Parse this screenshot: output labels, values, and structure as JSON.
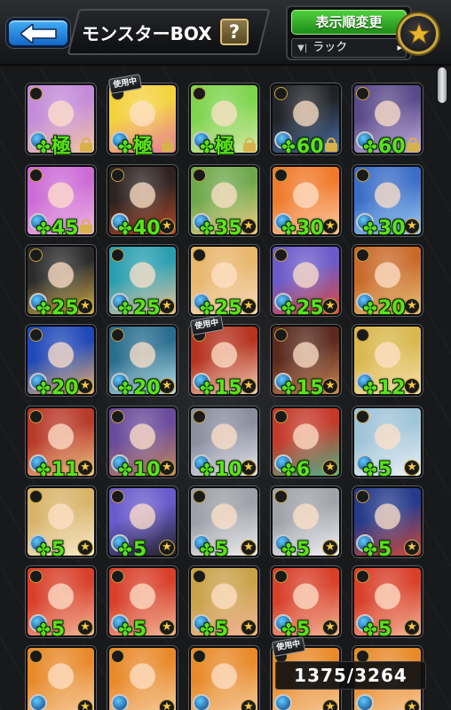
{
  "header": {
    "back_label": "",
    "title": "モンスターBOX",
    "help_label": "?",
    "sort_button_label": "表示順変更",
    "sort_value": "ラック"
  },
  "in_use_label": "使用中",
  "counter": "1375/3264",
  "colors": {
    "level_text": "#5ce21a",
    "back_button": "#2a8ee0",
    "sort_button": "#34ab28",
    "gold": "#c9a53b"
  },
  "icons": [
    "back-arrow-icon",
    "help-icon",
    "filter-icon",
    "dropdown-arrow-icon",
    "favorite-star-icon",
    "clover-icon",
    "lock-icon",
    "element-icon",
    "star-mark-icon"
  ],
  "monsters": [
    {
      "level": "極",
      "palette": [
        "#c38bd8",
        "#f3c6a7"
      ],
      "locked": true,
      "in_use": false
    },
    {
      "level": "極",
      "palette": [
        "#f4d23f",
        "#e87da1"
      ],
      "locked": true,
      "in_use": true
    },
    {
      "level": "極",
      "palette": [
        "#7ed44e",
        "#d7e9a8"
      ],
      "locked": true,
      "in_use": false
    },
    {
      "level": "60",
      "palette": [
        "#202428",
        "#4a6fa5"
      ],
      "locked": true,
      "in_use": false
    },
    {
      "level": "60",
      "palette": [
        "#5b4a8a",
        "#c7b3e2"
      ],
      "locked": true,
      "in_use": false
    },
    {
      "level": "45",
      "palette": [
        "#cc6bd6",
        "#f0b8e4"
      ],
      "locked": true,
      "in_use": false
    },
    {
      "level": "40",
      "palette": [
        "#2e2320",
        "#b84a2a"
      ],
      "locked": false,
      "in_use": false
    },
    {
      "level": "35",
      "palette": [
        "#6fa84c",
        "#f1d08a"
      ],
      "locked": false,
      "in_use": false
    },
    {
      "level": "30",
      "palette": [
        "#f07a2b",
        "#ffd0b0"
      ],
      "locked": false,
      "in_use": false
    },
    {
      "level": "30",
      "palette": [
        "#3c6ec8",
        "#9fd0f4"
      ],
      "locked": false,
      "in_use": false
    },
    {
      "level": "25",
      "palette": [
        "#2b2b2b",
        "#d4b14a"
      ],
      "locked": false,
      "in_use": false
    },
    {
      "level": "25",
      "palette": [
        "#2a9fb0",
        "#f2c69d"
      ],
      "locked": false,
      "in_use": false
    },
    {
      "level": "25",
      "palette": [
        "#e8b66c",
        "#f7dcc0"
      ],
      "locked": false,
      "in_use": false
    },
    {
      "level": "25",
      "palette": [
        "#6b5ac9",
        "#e04c3a"
      ],
      "locked": false,
      "in_use": false
    },
    {
      "level": "20",
      "palette": [
        "#c96a2a",
        "#e8c37a"
      ],
      "locked": false,
      "in_use": false
    },
    {
      "level": "20",
      "palette": [
        "#1f48b8",
        "#f2b56d"
      ],
      "locked": false,
      "in_use": false
    },
    {
      "level": "20",
      "palette": [
        "#2a6e8f",
        "#bfe4e8"
      ],
      "locked": false,
      "in_use": false
    },
    {
      "level": "15",
      "palette": [
        "#b5331f",
        "#f3d3bd"
      ],
      "locked": false,
      "in_use": true
    },
    {
      "level": "15",
      "palette": [
        "#5a2a1e",
        "#c9885a"
      ],
      "locked": false,
      "in_use": false
    },
    {
      "level": "12",
      "palette": [
        "#d9b84e",
        "#f6e3b0"
      ],
      "locked": false,
      "in_use": false
    },
    {
      "level": "11",
      "palette": [
        "#b83a2a",
        "#f2c98a"
      ],
      "locked": false,
      "in_use": false
    },
    {
      "level": "10",
      "palette": [
        "#6a4a9b",
        "#c48a5a"
      ],
      "locked": false,
      "in_use": false
    },
    {
      "level": "10",
      "palette": [
        "#8a8fa0",
        "#e8e8ee"
      ],
      "locked": false,
      "in_use": false
    },
    {
      "level": "6",
      "palette": [
        "#c33a2a",
        "#4fb48a"
      ],
      "locked": false,
      "in_use": false
    },
    {
      "level": "5",
      "palette": [
        "#9fc4d8",
        "#eef3f7"
      ],
      "locked": false,
      "in_use": false
    },
    {
      "level": "5",
      "palette": [
        "#d8b46a",
        "#f8ecd0"
      ],
      "locked": false,
      "in_use": false
    },
    {
      "level": "5",
      "palette": [
        "#6a5acb",
        "#222226"
      ],
      "locked": false,
      "in_use": false
    },
    {
      "level": "5",
      "palette": [
        "#9da0a8",
        "#f0f0f3"
      ],
      "locked": false,
      "in_use": false
    },
    {
      "level": "5",
      "palette": [
        "#a0a3aa",
        "#f3f3f6"
      ],
      "locked": false,
      "in_use": false
    },
    {
      "level": "5",
      "palette": [
        "#263a8a",
        "#d04a3a"
      ],
      "locked": false,
      "in_use": false
    },
    {
      "level": "5",
      "palette": [
        "#d8402a",
        "#f3b69a"
      ],
      "locked": false,
      "in_use": false
    },
    {
      "level": "5",
      "palette": [
        "#d8402a",
        "#f3b69a"
      ],
      "locked": false,
      "in_use": false
    },
    {
      "level": "5",
      "palette": [
        "#c9a24a",
        "#f3b69a"
      ],
      "locked": false,
      "in_use": false
    },
    {
      "level": "5",
      "palette": [
        "#d8402a",
        "#f3b69a"
      ],
      "locked": false,
      "in_use": false
    },
    {
      "level": "5",
      "palette": [
        "#d8402a",
        "#f3b69a"
      ],
      "locked": false,
      "in_use": false
    },
    {
      "level": "",
      "palette": [
        "#e88a2a",
        "#f7d0a6"
      ],
      "locked": false,
      "in_use": false
    },
    {
      "level": "",
      "palette": [
        "#e88a2a",
        "#f7d0a6"
      ],
      "locked": false,
      "in_use": false
    },
    {
      "level": "",
      "palette": [
        "#e88a2a",
        "#f7d0a6"
      ],
      "locked": false,
      "in_use": false
    },
    {
      "level": "",
      "palette": [
        "#e88a2a",
        "#f7d0a6"
      ],
      "locked": false,
      "in_use": true
    },
    {
      "level": "",
      "palette": [
        "#e88a2a",
        "#f7d0a6"
      ],
      "locked": false,
      "in_use": false
    }
  ]
}
